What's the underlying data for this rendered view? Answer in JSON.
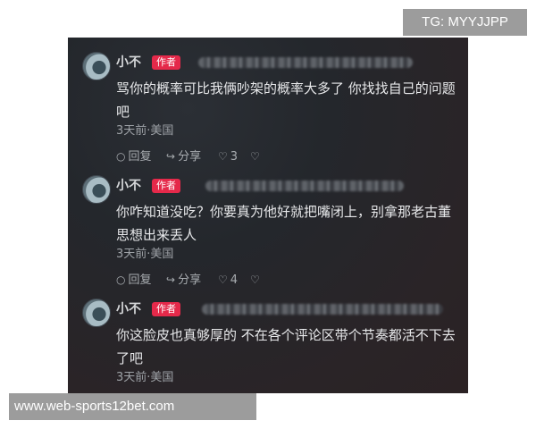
{
  "overlay": {
    "tg_label": "TG: MYYJJPP",
    "website_label": "www.web-sports12bet.com"
  },
  "comments": [
    {
      "username": "小不",
      "badge": "作者",
      "text": "骂你的概率可比我俩吵架的概率大多了 你找找自己的问题吧",
      "meta": "3天前·美国",
      "reply_label": "回复",
      "share_label": "分享",
      "like_count": "3"
    },
    {
      "username": "小不",
      "badge": "作者",
      "text": "你咋知道没吃？你要真为他好就把嘴闭上，别拿那老古董思想出来丢人",
      "meta": "3天前·美国",
      "reply_label": "回复",
      "share_label": "分享",
      "like_count": "4"
    },
    {
      "username": "小不",
      "badge": "作者",
      "text": "你这脸皮也真够厚的 不在各个评论区带个节奏都活不下去了吧",
      "meta": "3天前·美国"
    }
  ],
  "icons": {
    "reply": "comment-bubble-icon",
    "share": "share-arrow-icon",
    "like": "heart-icon",
    "dislike": "broken-heart-icon"
  },
  "colors": {
    "badge": "#e5294a",
    "background": "#26292e",
    "text": "#e7e8ea",
    "meta": "#9ea2a7"
  }
}
